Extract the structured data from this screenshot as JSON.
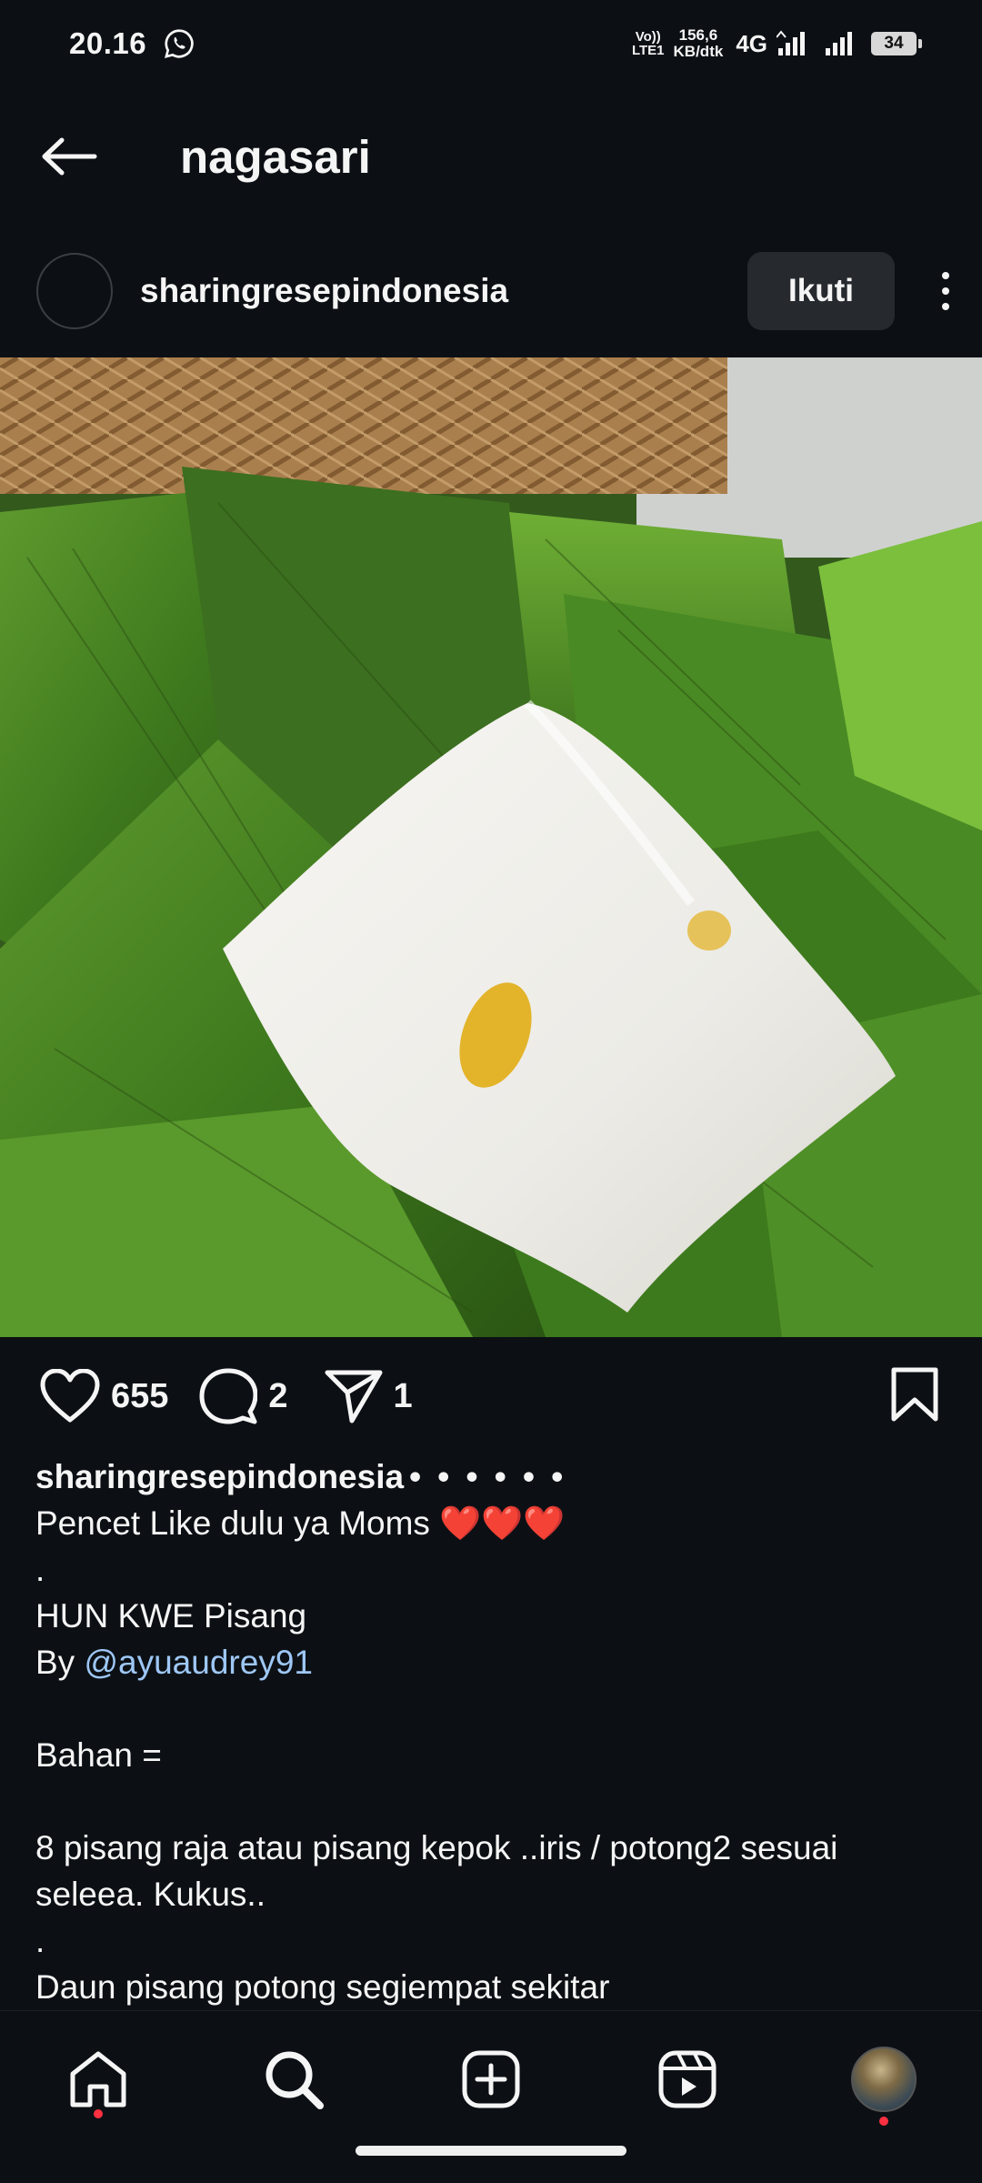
{
  "status_bar": {
    "time": "20.16",
    "volte_top": "Vo))",
    "volte_bottom": "LTE1",
    "speed_value": "156,6",
    "speed_unit": "KB/dtk",
    "network": "4G",
    "battery": "34",
    "icons": [
      "whatsapp-icon",
      "signal-icon",
      "signal-icon",
      "battery-icon"
    ]
  },
  "header": {
    "title": "nagasari",
    "back_icon": "arrow-left-icon"
  },
  "post": {
    "author": "sharingresepindonesia",
    "follow_label": "Ikuti",
    "more_icon": "more-vertical-icon",
    "photo_description_icon": "post-photo"
  },
  "actions": {
    "likes": "655",
    "comments": "2",
    "shares": "1"
  },
  "caption": {
    "user": "sharingresepindonesia",
    "dots": "• • • • • •",
    "line1_text": "Pencet Like dulu ya Moms ",
    "line1_emoji": "❤️❤️❤️",
    "line2": ".",
    "line3": "HUN KWE Pisang",
    "line4_prefix": "By ",
    "line4_mention": "@ayuaudrey91",
    "line5": "",
    "line6": "Bahan =",
    "line7": "",
    "line8": "8 pisang raja atau pisang kepok ..iris / potong2 sesuai",
    "line9": "seleea. Kukus..",
    "line10": ".",
    "line11": "Daun pisang potong segiempat sekitar"
  },
  "bottom_nav": {
    "items": [
      "home-icon",
      "search-icon",
      "create-icon",
      "reels-icon",
      "profile-avatar"
    ]
  }
}
